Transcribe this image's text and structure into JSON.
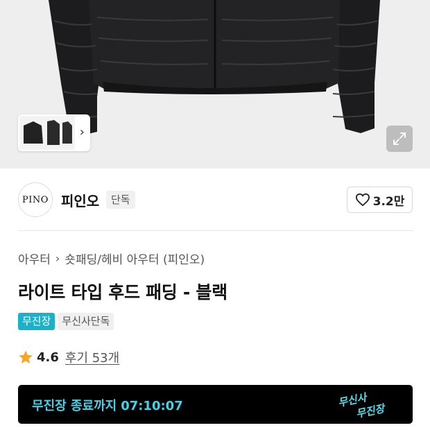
{
  "gallery": {
    "main_image": "black-padded-hood-jacket-photo",
    "thumbnail_icon": "jacket-thumbnails",
    "thumbnail_next_icon": "chevron-right-icon",
    "expand_icon": "expand-icon"
  },
  "brand": {
    "logo_text": "PINO",
    "name": "피인오",
    "badge": "단독",
    "like_icon": "heart-icon",
    "like_count": "3.2만"
  },
  "breadcrumb": {
    "items": [
      "아우터",
      "숏패딩/헤비 아우터 (피인오)"
    ],
    "separator_icon": "chevron-right-icon"
  },
  "product": {
    "title": "라이트 타입 후드 패딩 - 블랙",
    "tags": [
      "무진장",
      "무신사단독"
    ]
  },
  "rating": {
    "star_icon": "star-icon",
    "value": "4.6",
    "reviews_label": "후기 53개"
  },
  "promo_banner": {
    "label": "무진장 종료까지",
    "countdown": "07:10:07",
    "logo_line1": "무신사",
    "logo_line2": "무진장"
  },
  "colors": {
    "accent_cyan": "#1bb2c9",
    "banner_text": "#3fd4ea",
    "star": "#f5a623"
  }
}
